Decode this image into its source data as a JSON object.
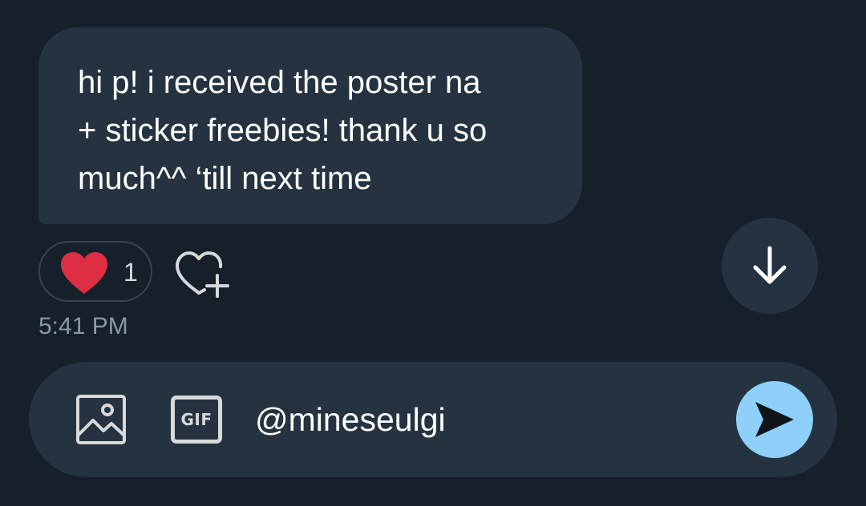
{
  "message": {
    "text": "hi p! i received the poster na\n+ sticker freebies! thank u so\nmuch^^ ‘till next time",
    "timestamp": "5:41 PM"
  },
  "reactions": {
    "heart_count": "1",
    "heart_icon": "red-heart-emoji",
    "add_reaction_icon": "heart-plus-icon"
  },
  "scroll": {
    "icon": "arrow-down-icon"
  },
  "composer": {
    "media_icon": "image-icon",
    "gif_label": "GIF",
    "input_value": "@mineseulgi",
    "send_icon": "send-icon"
  },
  "colors": {
    "background": "#15202b",
    "bubble": "#253341",
    "heart": "#dd2e44",
    "send": "#8ed0f9",
    "muted_text": "#8899a6"
  }
}
